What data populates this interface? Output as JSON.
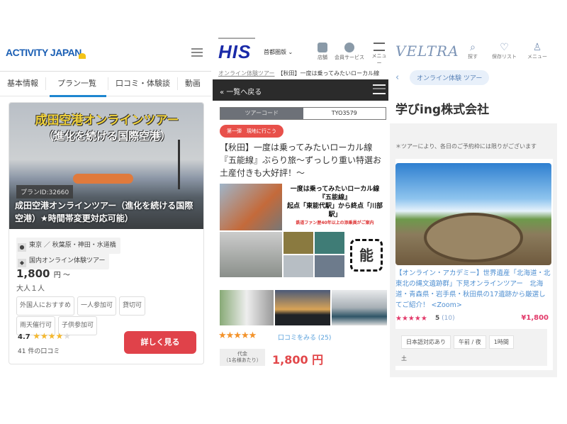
{
  "activity_japan": {
    "logo": "ACTIVITY JAPAN",
    "tabs": [
      "基本情報",
      "プラン一覧",
      "口コミ・体験談",
      "動画"
    ],
    "active_tab": "プラン一覧",
    "card": {
      "image_title_line1": "成田空港オンラインツアー",
      "image_title_line2": "（進化を続ける国際空港）",
      "plan_id": "プランID:32660",
      "title": "成田空港オンラインツアー（進化を続ける国際空港）★時間帯変更対応可能）",
      "location": "東京 ／ 秋葉原・神田・水道橋",
      "category": "国内オンライン体験ツアー",
      "price": "1,800",
      "price_unit": "円 〜",
      "price_note": "大人１人",
      "tags": [
        "外国人におすすめ",
        "一人参加可",
        "貸切可",
        "雨天催行可",
        "子供参加可"
      ],
      "rating": "4.7",
      "rating_value": 4.7,
      "reviews": "41 件の口コミ",
      "detail_button": "詳しく見る"
    }
  },
  "his": {
    "logo": "HIS",
    "region": "首都圏版",
    "header_icons": [
      {
        "icon": "store-icon",
        "label": "店舗"
      },
      {
        "icon": "user-icon",
        "label": "会員サービス"
      },
      {
        "icon": "menu-icon",
        "label": "メニュー"
      }
    ],
    "breadcrumb": [
      "オンライン体験ツアー",
      "【秋田】一度は乗ってみたいローカル線"
    ],
    "back_label": "一覧へ戻る",
    "tour_code_label": "ツアーコード",
    "tour_code": "TYO3579",
    "badge": "第一弾　現地に行こう",
    "title": "【秋田】一度は乗ってみたいローカル線『五能線』ぶらり旅〜ずっしり重い特選お土産付きも大好評！〜",
    "image_text": {
      "line1": "一度は乗ってみたいローカル線",
      "line2": "『五能線』",
      "line3": "起点「東能代駅」から終点「川部駅」",
      "line4": "鉄道ファン歴40年以上の添乗員がご案内",
      "logo_char": "能"
    },
    "stars": "★★★★★",
    "reviews_link": "口コミをみる (25)",
    "price_label": "代金",
    "price_sub": "（1名様あたり）",
    "price": "1,800 円",
    "colors": {
      "brand": "#1a2aa8",
      "accent": "#e2474a",
      "star": "#f3932b"
    }
  },
  "veltra": {
    "logo": "VELTRA",
    "header_icons": [
      {
        "icon": "search-icon",
        "label": "探す"
      },
      {
        "icon": "heart-icon",
        "label": "保存リスト"
      },
      {
        "icon": "user-icon",
        "label": "メニュー"
      }
    ],
    "category_pill": "オンライン体験 ツアー",
    "company": "学びing株式会社",
    "note": "＊ツアーにより、各日のご予約枠には限りがございます",
    "card": {
      "title": "【オンライン・アカデミー】世界遺産「北海道・北東北の縄文遺跡群」下見オンラインツアー　北海道・青森県・岩手県・秋田県の17遺跡から厳選してご紹介！ <Zoom>",
      "stars": "★★★★★",
      "rating": "5",
      "reviews": "(10)",
      "price": "¥1,800",
      "tags": [
        "日本語対応あり",
        "午前 / 夜",
        "1時間"
      ],
      "day": "土"
    }
  }
}
